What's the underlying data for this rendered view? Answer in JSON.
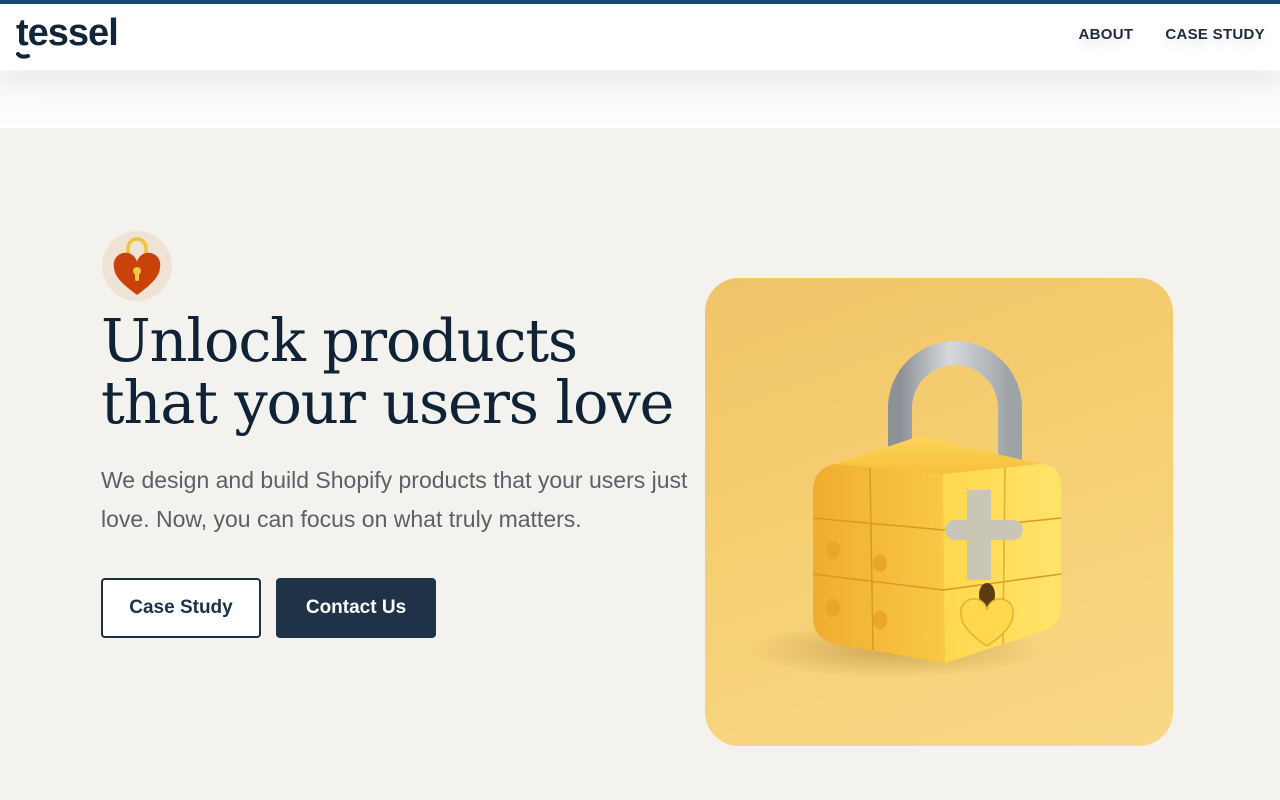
{
  "brand": {
    "logo_text": "tessel",
    "color": "#12263a",
    "accent": "#1c4a73"
  },
  "nav": {
    "items": [
      {
        "label": "ABOUT"
      },
      {
        "label": "CASE STUDY"
      }
    ]
  },
  "hero": {
    "icon": "heart-padlock-icon",
    "title": "Unlock products that your users love",
    "subtitle": "We design and build Shopify products that your users just love. Now, you can focus on what truly matters.",
    "buttons": {
      "case_study": "Case Study",
      "contact": "Contact Us"
    },
    "illustration": "yellow-padlock-illustration"
  },
  "colors": {
    "background": "#f4f2ee",
    "button_dark": "#1f3247",
    "illustration_bg": "#f3c970"
  }
}
